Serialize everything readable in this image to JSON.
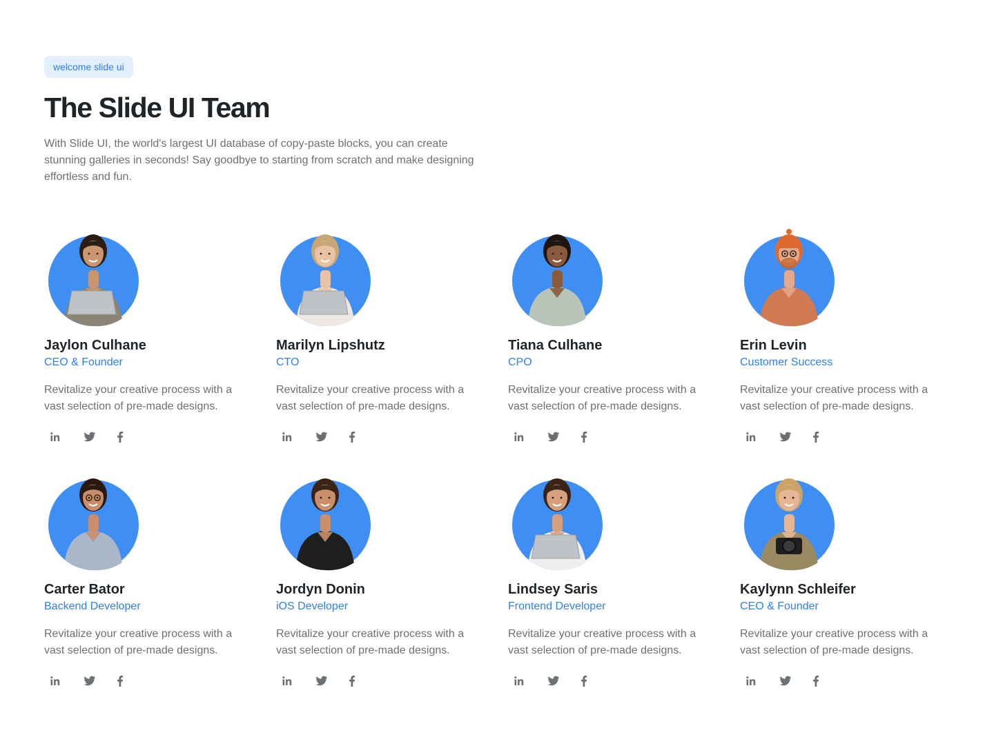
{
  "header": {
    "badge": "welcome slide ui",
    "title": "The Slide UI Team",
    "lead": "With Slide UI, the world's largest UI database of copy-paste blocks, you can create stunning galleries in seconds! Say goodbye to starting from scratch and make designing effortless and fun."
  },
  "colors": {
    "accent": "#2f80ed",
    "avatar_bg": "#3f8ef3",
    "text_muted": "#6b7075",
    "badge_bg": "#e3effd"
  },
  "social_icons": [
    "linkedin-icon",
    "twitter-icon",
    "facebook-icon"
  ],
  "team": [
    {
      "name": "Jaylon Culhane",
      "role": "CEO & Founder",
      "desc": "Revitalize your creative process with a vast selection of pre-made designs.",
      "skin": "#c9966f",
      "hair": "#2b1d14",
      "shirt": "#8b8374",
      "prop": "laptop"
    },
    {
      "name": "Marilyn Lipshutz",
      "role": "CTO",
      "desc": "Revitalize your creative process with a vast selection of pre-made designs.",
      "skin": "#e8c2a2",
      "hair": "#c9a774",
      "shirt": "#efe7e2",
      "prop": "laptop"
    },
    {
      "name": "Tiana Culhane",
      "role": "CPO",
      "desc": "Revitalize your creative process with a vast selection of pre-made designs.",
      "skin": "#8a5a3c",
      "hair": "#1e1410",
      "shirt": "#b9c4b8",
      "prop": "none"
    },
    {
      "name": "Erin Levin",
      "role": "Customer Success",
      "desc": "Revitalize your creative process with a vast selection of pre-made designs.",
      "skin": "#e2a98a",
      "hair": "#e06a2c",
      "shirt": "#d27a52",
      "prop": "hat"
    },
    {
      "name": "Carter Bator",
      "role": "Backend Developer",
      "desc": "Revitalize your creative process with a vast selection of pre-made designs.",
      "skin": "#c98d6c",
      "hair": "#2a1a12",
      "shirt": "#a9b7c9",
      "prop": "glasses"
    },
    {
      "name": "Jordyn Donin",
      "role": "iOS Developer",
      "desc": "Revitalize your creative process with a vast selection of pre-made designs.",
      "skin": "#c98e6a",
      "hair": "#3a2418",
      "shirt": "#1e1e1e",
      "prop": "none"
    },
    {
      "name": "Lindsey Saris",
      "role": "Frontend Developer",
      "desc": "Revitalize your creative process with a vast selection of pre-made designs.",
      "skin": "#d6a07c",
      "hair": "#3a2418",
      "shirt": "#eeeeee",
      "prop": "laptop"
    },
    {
      "name": "Kaylynn Schleifer",
      "role": "CEO & Founder",
      "desc": "Revitalize your creative process with a vast selection of pre-made designs.",
      "skin": "#e5b595",
      "hair": "#caa468",
      "shirt": "#9a8a62",
      "prop": "camera"
    }
  ]
}
